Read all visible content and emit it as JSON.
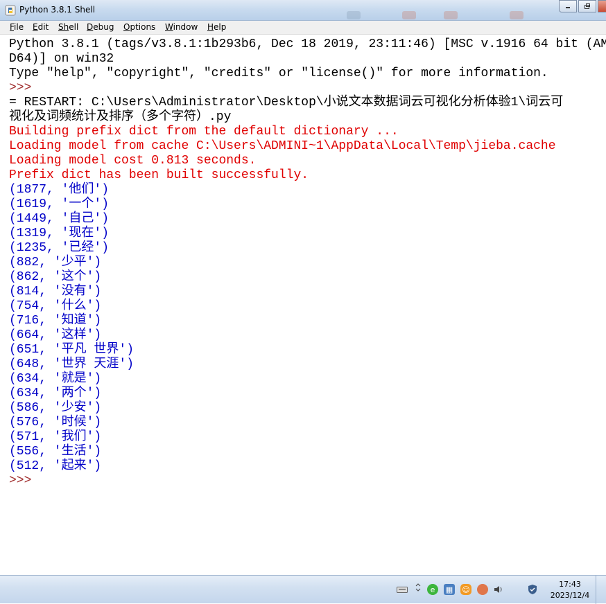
{
  "window": {
    "title": "Python 3.8.1 Shell"
  },
  "menu": [
    {
      "label": "File",
      "u": "F",
      "rest": "ile"
    },
    {
      "label": "Edit",
      "u": "E",
      "rest": "dit"
    },
    {
      "label": "Shell",
      "u": "Sh",
      "rest": "ell"
    },
    {
      "label": "Debug",
      "u": "D",
      "rest": "ebug"
    },
    {
      "label": "Options",
      "u": "O",
      "rest": "ptions"
    },
    {
      "label": "Window",
      "u": "W",
      "rest": "indow"
    },
    {
      "label": "Help",
      "u": "H",
      "rest": "elp"
    }
  ],
  "shell_lines": [
    {
      "text": "Python 3.8.1 (tags/v3.8.1:1b293b6, Dec 18 2019, 23:11:46) [MSC v.1916 64 bit (AM",
      "color": "black"
    },
    {
      "text": "D64)] on win32",
      "color": "black"
    },
    {
      "text": "Type \"help\", \"copyright\", \"credits\" or \"license()\" for more information.",
      "color": "black"
    },
    {
      "text": ">>>",
      "color": "prompt"
    },
    {
      "text": "= RESTART: C:\\Users\\Administrator\\Desktop\\小说文本数据词云可视化分析体验1\\词云可",
      "color": "black"
    },
    {
      "text": "视化及词频统计及排序（多个字符）.py",
      "color": "black"
    },
    {
      "text": "Building prefix dict from the default dictionary ...",
      "color": "red"
    },
    {
      "text": "Loading model from cache C:\\Users\\ADMINI~1\\AppData\\Local\\Temp\\jieba.cache",
      "color": "red"
    },
    {
      "text": "Loading model cost 0.813 seconds.",
      "color": "red"
    },
    {
      "text": "Prefix dict has been built successfully.",
      "color": "red"
    },
    {
      "text": "(1877, '他们')",
      "color": "blue"
    },
    {
      "text": "(1619, '一个')",
      "color": "blue"
    },
    {
      "text": "(1449, '自己')",
      "color": "blue"
    },
    {
      "text": "(1319, '现在')",
      "color": "blue"
    },
    {
      "text": "(1235, '已经')",
      "color": "blue"
    },
    {
      "text": "(882, '少平')",
      "color": "blue"
    },
    {
      "text": "(862, '这个')",
      "color": "blue"
    },
    {
      "text": "(814, '没有')",
      "color": "blue"
    },
    {
      "text": "(754, '什么')",
      "color": "blue"
    },
    {
      "text": "(716, '知道')",
      "color": "blue"
    },
    {
      "text": "(664, '这样')",
      "color": "blue"
    },
    {
      "text": "(651, '平凡 世界')",
      "color": "blue"
    },
    {
      "text": "(648, '世界 天涯')",
      "color": "blue"
    },
    {
      "text": "(634, '就是')",
      "color": "blue"
    },
    {
      "text": "(634, '两个')",
      "color": "blue"
    },
    {
      "text": "(586, '少安')",
      "color": "blue"
    },
    {
      "text": "(576, '时候')",
      "color": "blue"
    },
    {
      "text": "(571, '我们')",
      "color": "blue"
    },
    {
      "text": "(556, '生活')",
      "color": "blue"
    },
    {
      "text": "(512, '起来')",
      "color": "blue"
    },
    {
      "text": ">>>",
      "color": "prompt"
    }
  ],
  "taskbar": {
    "time": "17:43",
    "date": "2023/12/4",
    "tray_icons": [
      "keyboard-icon",
      "expand-icon",
      "green-app-icon",
      "network-icon",
      "orange-app-icon",
      "cloud-app-icon",
      "volume-icon",
      "shield-icon"
    ]
  },
  "colors": {
    "black": "#000000",
    "red": "#e00000",
    "blue": "#0000c8",
    "prompt": "#a12f2f"
  }
}
